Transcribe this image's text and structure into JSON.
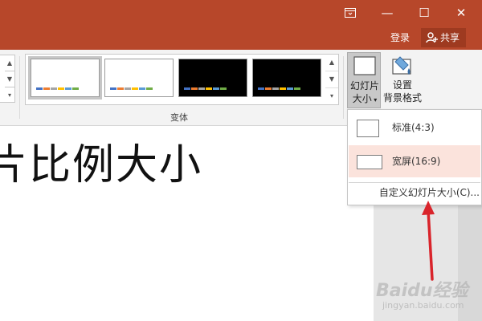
{
  "window": {
    "restore_icon": "ribbon-display-icon",
    "minimize_glyph": "—",
    "maximize_glyph": "☐",
    "close_glyph": "✕"
  },
  "account": {
    "sign_in_label": "登录",
    "share_label": "共享",
    "share_icon": "person-add-icon"
  },
  "ribbon": {
    "variants_group_label": "变体",
    "variants": [
      {
        "background": "#ffffff",
        "selected": true
      },
      {
        "background": "#ffffff",
        "selected": false
      },
      {
        "background": "#000000",
        "selected": false
      },
      {
        "background": "#000000",
        "selected": false
      }
    ],
    "swatch_colors": [
      "#4472c4",
      "#ed7d31",
      "#a5a5a5",
      "#ffc000",
      "#5b9bd5",
      "#70ad47"
    ],
    "slide_size_button": {
      "line1": "幻灯片",
      "line2": "大小"
    },
    "format_background_button": {
      "line1": "设置",
      "line2": "背景格式"
    }
  },
  "slide": {
    "title_text": "片比例大小"
  },
  "slide_size_menu": {
    "items": [
      {
        "label": "标准(4:3)",
        "icon": "standard-ratio-icon"
      },
      {
        "label": "宽屏(16:9)",
        "icon": "widescreen-ratio-icon"
      }
    ],
    "custom_label": "自定义幻灯片大小(C)..."
  },
  "watermark": {
    "brand": "Baidu经验",
    "url": "jingyan.baidu.com"
  },
  "colors": {
    "title_bar": "#b7472a",
    "hover_item": "#fbe3dc",
    "arrow": "#d9242b"
  }
}
